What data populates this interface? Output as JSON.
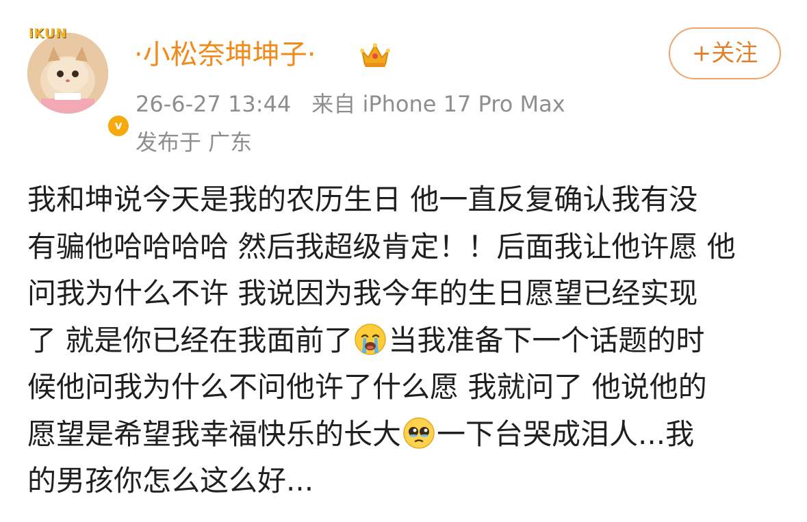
{
  "author": {
    "avatar_badge": "iKUN",
    "name": "·小松奈坤坤子·",
    "verified_mark": "v",
    "crown_icon": "crown-icon"
  },
  "follow_button": {
    "label": "+关注"
  },
  "meta": {
    "timestamp": "26-6-27 13:44",
    "source": "来自 iPhone 17 Pro Max",
    "location": "发布于 广东"
  },
  "post": {
    "lines": [
      {
        "text": "我和坤说今天是我的农历生日 他一直反复确认我有没"
      },
      {
        "text": "有骗他哈哈哈哈 然后我超级肯定！！后面我让他许愿 他"
      },
      {
        "text": "问我为什么不许 我说因为我今年的生日愿望已经实现"
      },
      {
        "before": "了 就是你已经在我面前了",
        "emoji": "loudly-crying-face-icon",
        "after": "当我准备下一个话题的时"
      },
      {
        "text": "候他问我为什么不问他许了什么愿 我就问了 他说他的"
      },
      {
        "before": "愿望是希望我幸福快乐的长大",
        "emoji": "pleading-face-icon",
        "after": "一下台哭成泪人...我"
      },
      {
        "text": "的男孩你怎么这么好..."
      }
    ]
  },
  "colors": {
    "username": "#f08a1a",
    "meta": "#8e8e8e",
    "follow_border": "#f0a36a",
    "follow_text": "#e0812e",
    "body_text": "#1f1f1f",
    "verified": "#f7a80a"
  }
}
